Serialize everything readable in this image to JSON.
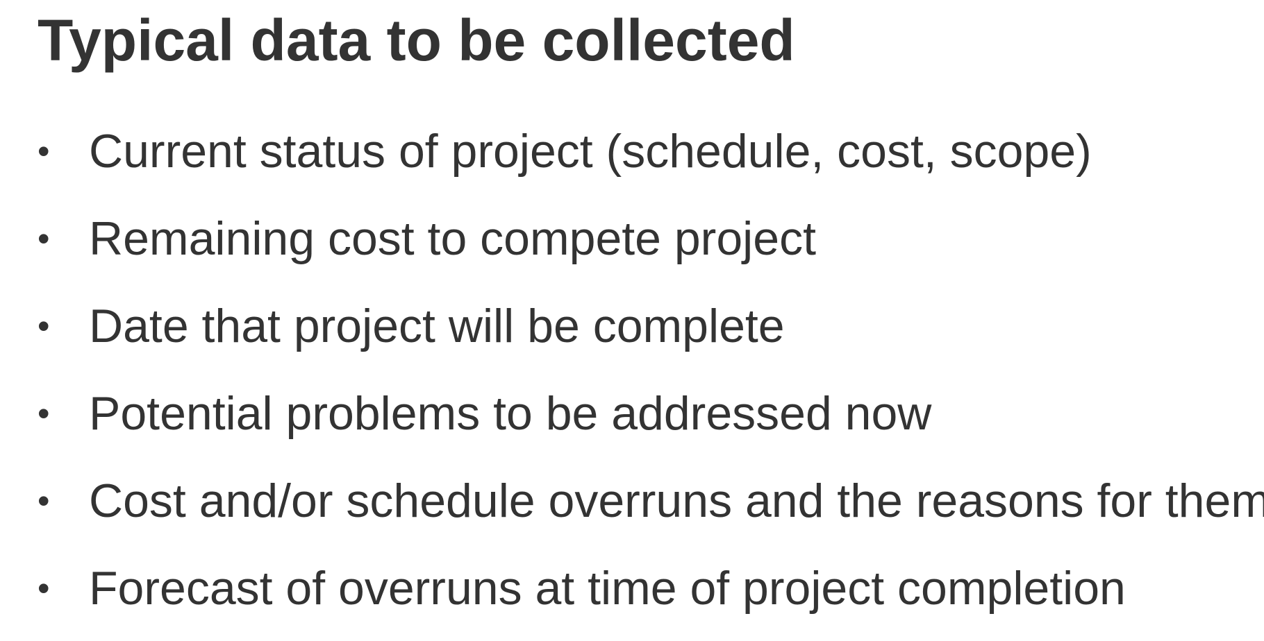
{
  "slide": {
    "title": "Typical data to be collected",
    "bullet_symbol": "•",
    "bullets": [
      "Current status of project (schedule, cost, scope)",
      "Remaining cost to compete project",
      "Date that project will be complete",
      "Potential problems to be addressed now",
      "Cost and/or schedule overruns and the reasons for them",
      "Forecast of overruns at time of project completion"
    ]
  }
}
